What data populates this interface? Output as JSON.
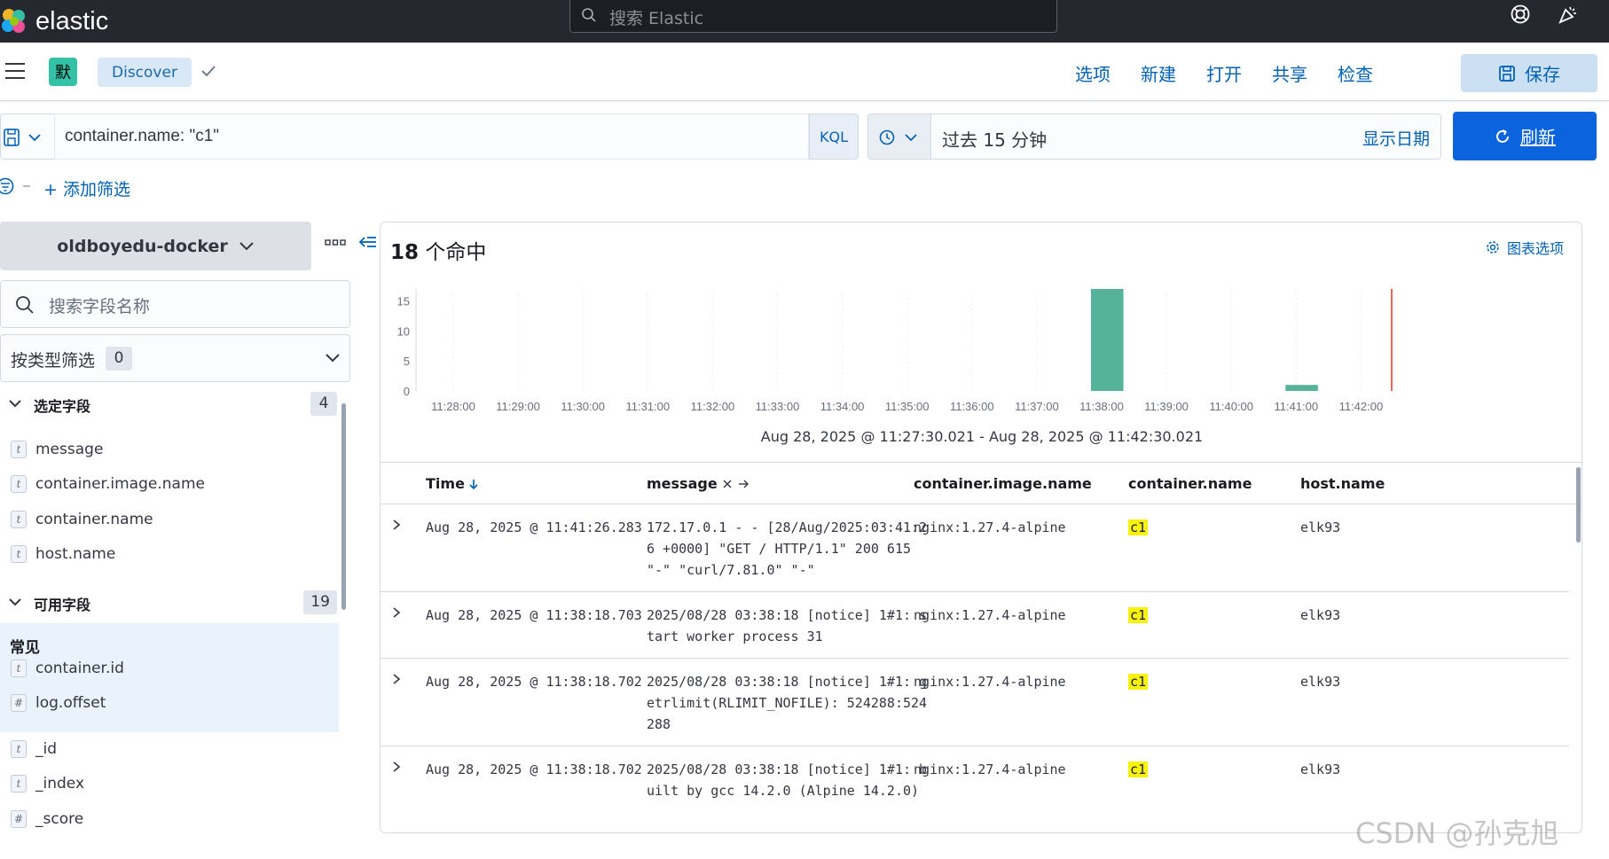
{
  "app": {
    "brand": "elastic",
    "search_placeholder": "搜索 Elastic"
  },
  "navbar": {
    "space_initial": "默",
    "breadcrumb": "Discover",
    "links": [
      "选项",
      "新建",
      "打开",
      "共享",
      "检查"
    ],
    "save_label": "保存"
  },
  "query": {
    "value": "container.name: \"c1\"",
    "language": "KQL",
    "time_range": "过去 15 分钟",
    "show_dates": "显示日期",
    "refresh_label": "刷新"
  },
  "filters": {
    "add_filter": "+ 添加筛选"
  },
  "sidebar": {
    "index_pattern": "oldboyedu-docker",
    "field_search_placeholder": "搜索字段名称",
    "type_filter_label": "按类型筛选",
    "type_filter_count": "0",
    "selected_title": "选定字段",
    "selected_count": "4",
    "selected_fields": [
      {
        "type": "t",
        "name": "message"
      },
      {
        "type": "t",
        "name": "container.image.name"
      },
      {
        "type": "t",
        "name": "container.name"
      },
      {
        "type": "t",
        "name": "host.name"
      }
    ],
    "available_title": "可用字段",
    "available_count": "19",
    "common_label": "常见",
    "common_fields": [
      {
        "type": "t",
        "name": "container.id"
      },
      {
        "type": "#",
        "name": "log.offset"
      }
    ],
    "other_fields": [
      {
        "type": "t",
        "name": "_id"
      },
      {
        "type": "t",
        "name": "_index"
      },
      {
        "type": "#",
        "name": "_score"
      }
    ]
  },
  "results": {
    "hits_count": "18",
    "hits_suffix": " 个命中",
    "chart_options": "图表选项",
    "time_range_label": "Aug 28, 2025 @ 11:27:30.021 - Aug 28, 2025 @ 11:42:30.021",
    "columns": [
      "Time",
      "message",
      "container.image.name",
      "container.name",
      "host.name"
    ],
    "rows": [
      {
        "time": "Aug 28, 2025 @ 11:41:26.283",
        "message": "172.17.0.1 - - [28/Aug/2025:03:41:26 +0000] \"GET / HTTP/1.1\" 200 615 \"-\" \"curl/7.81.0\" \"-\"",
        "image": "nginx:1.27.4-alpine",
        "container": "c1",
        "host": "elk93"
      },
      {
        "time": "Aug 28, 2025 @ 11:38:18.703",
        "message": "2025/08/28 03:38:18 [notice] 1#1: start worker process 31",
        "image": "nginx:1.27.4-alpine",
        "container": "c1",
        "host": "elk93"
      },
      {
        "time": "Aug 28, 2025 @ 11:38:18.702",
        "message": "2025/08/28 03:38:18 [notice] 1#1: getrlimit(RLIMIT_NOFILE): 524288:524288",
        "image": "nginx:1.27.4-alpine",
        "container": "c1",
        "host": "elk93"
      },
      {
        "time": "Aug 28, 2025 @ 11:38:18.702",
        "message": "2025/08/28 03:38:18 [notice] 1#1: built by gcc 14.2.0 (Alpine 14.2.0)",
        "image": "nginx:1.27.4-alpine",
        "container": "c1",
        "host": "elk93"
      }
    ]
  },
  "chart_data": {
    "type": "bar",
    "x_ticks": [
      "11:28:00",
      "11:29:00",
      "11:30:00",
      "11:31:00",
      "11:32:00",
      "11:33:00",
      "11:34:00",
      "11:35:00",
      "11:36:00",
      "11:37:00",
      "11:38:00",
      "11:39:00",
      "11:40:00",
      "11:41:00",
      "11:42:00"
    ],
    "y_ticks": [
      "0",
      "5",
      "10",
      "15"
    ],
    "ylim": [
      0,
      17
    ],
    "bars": [
      {
        "x": "11:38:00",
        "value": 17
      },
      {
        "x": "11:41:00",
        "value": 1
      }
    ],
    "bar_color": "#54b399",
    "now_marker_color": "#e7664c"
  },
  "watermark": "CSDN @孙克旭"
}
